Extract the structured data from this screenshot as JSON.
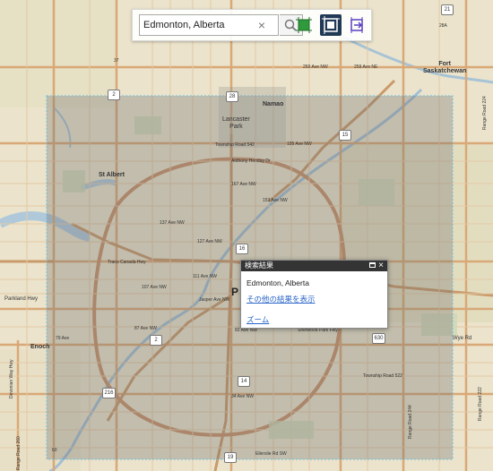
{
  "search": {
    "value": "Edmonton, Alberta",
    "clear_symbol": "×"
  },
  "tools": [
    {
      "name": "extent-tool"
    },
    {
      "name": "select-area-tool",
      "active": true
    },
    {
      "name": "clip-tool"
    }
  ],
  "popup": {
    "header": "検索結果",
    "title": "Edmonton, Alberta",
    "more_results": "その他の結果を表示",
    "zoom": "ズーム",
    "close_symbol": "×"
  },
  "map_labels": {
    "fort_saskatchewan": "Fort\nSaskatchewan",
    "namao": "Namao",
    "lancaster_park": "Lancaster\nPark",
    "st_albert": "St Albert",
    "parkland_hwy": "Parkland Hwy",
    "enoch": "Enoch",
    "wye_rd": "Wye Rd",
    "township_542": "Township Road 542",
    "ave_195": "195 Ave NW",
    "anthony_henday": "Anthony Henday Dr",
    "ave_167": "167 Ave NW",
    "ave_153": "153 Ave NW",
    "ave_137": "137 Ave NW",
    "ave_127": "127 Ave NW",
    "ave_111": "111 Ave NW",
    "ave_107": "107 Ave NW",
    "ave_87": "87 Ave NW",
    "ave_82": "82 Ave NW",
    "ave_79": "79 Ave",
    "ave_34": "34 Ave NW",
    "ave_259": "259 Ave NW",
    "ave_259_ne": "259 Ave NE",
    "sherwood_park": "Sherwood Park Fwy",
    "township_522": "Township Road 522",
    "ellerslie": "Ellerslie Rd SW",
    "jasper_ave": "Jasper Ave NW",
    "yellowhead": "Yellowhead Trail NW",
    "trans_canada": "Trans Canada Hwy",
    "range_rd_224": "Range Road 224",
    "range_rd_222": "Range Road 222",
    "range_rd_244": "Range Road 244",
    "devonian_way": "Devonian Way Hwy",
    "range_rd_260": "Range Road 260",
    "hwy_2": "2",
    "hwy_28": "28",
    "hwy_15": "15",
    "hwy_16": "16",
    "hwy_216": "216",
    "hwy_14": "14",
    "hwy_630": "630",
    "hwy_28a": "28A",
    "hwy_37": "37",
    "hwy_19": "19",
    "hwy_60": "60",
    "hwy_21": "21"
  }
}
